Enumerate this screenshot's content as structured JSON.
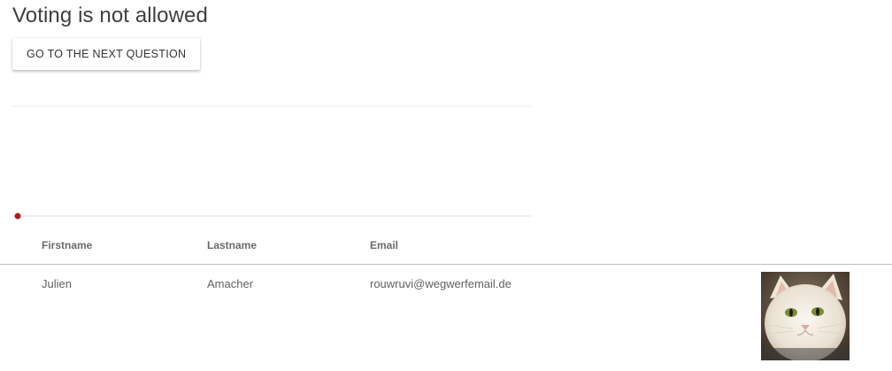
{
  "header": {
    "title": "Voting is not allowed",
    "next_button_label": "GO TO THE NEXT QUESTION"
  },
  "chart_data": {
    "type": "line",
    "title": "",
    "xlabel": "",
    "ylabel": "",
    "series": [
      {
        "values": [
          0
        ]
      }
    ],
    "grid": true,
    "colors": {
      "point": "#b71c1c",
      "gridline": "#ececec",
      "axis": "#dddddd"
    }
  },
  "table": {
    "columns": [
      "Firstname",
      "Lastname",
      "Email"
    ],
    "rows": [
      {
        "firstname": "Julien",
        "lastname": "Amacher",
        "email": "rouwruvi@wegwerfemail.de",
        "avatar": "cat-photo"
      }
    ]
  }
}
